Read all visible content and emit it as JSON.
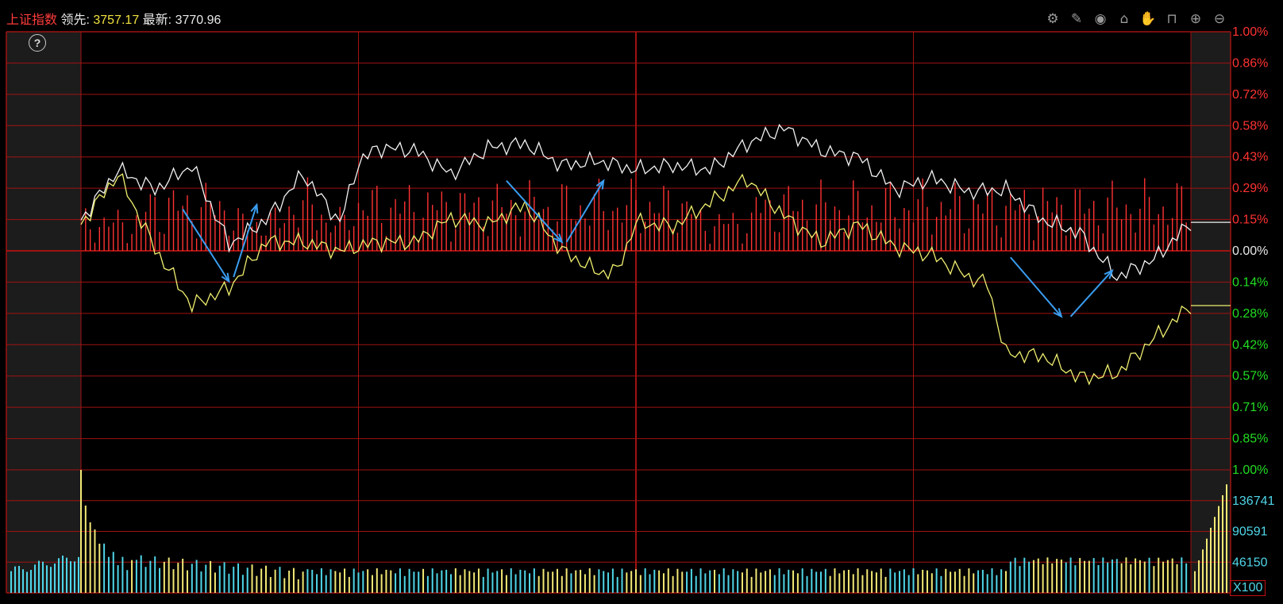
{
  "header": {
    "index_name": "上证指数",
    "lead_label": "领先:",
    "lead_value": "3757.17",
    "latest_label": "最新:",
    "latest_value": "3770.96"
  },
  "toolbar": {
    "icons": [
      "gear-icon",
      "pen-icon",
      "eye-icon",
      "tool-box-icon",
      "hand-icon",
      "lock-icon",
      "zoom-in-icon",
      "zoom-out-icon"
    ]
  },
  "colors": {
    "grid": "#a01212",
    "up": "#ff3232",
    "down": "#22dd22",
    "white_line": "#f2f2f2",
    "yellow_line": "#f0ef70",
    "volume_yellow": "#f2e874",
    "volume_cyan": "#4fd6e8",
    "arrow": "#3a9df0"
  },
  "volume_multiplier": "X100",
  "chart_data": [
    {
      "type": "line",
      "panel": "intraday price",
      "y_labels_right": [
        "1.00%",
        "0.86%",
        "0.72%",
        "0.58%",
        "0.43%",
        "0.29%",
        "0.15%",
        "0.00%",
        "0.14%",
        "0.28%",
        "0.42%",
        "0.57%",
        "0.71%",
        "0.85%",
        "1.00%"
      ],
      "ylim": [
        -1.0,
        1.0
      ],
      "x_range": [
        0,
        240
      ],
      "series": [
        {
          "color": "white",
          "x": [
            0,
            8,
            16,
            24,
            32,
            40,
            48,
            56,
            60,
            64,
            72,
            80,
            88,
            96,
            104,
            112,
            120,
            128,
            136,
            144,
            152,
            160,
            164,
            168,
            176,
            184,
            192,
            200,
            208,
            216,
            224,
            232,
            240
          ],
          "y": [
            0.14,
            0.37,
            0.28,
            0.39,
            0.03,
            0.14,
            0.35,
            0.13,
            0.4,
            0.47,
            0.46,
            0.35,
            0.47,
            0.49,
            0.39,
            0.41,
            0.37,
            0.39,
            0.37,
            0.49,
            0.56,
            0.46,
            0.44,
            0.43,
            0.28,
            0.33,
            0.27,
            0.28,
            0.14,
            0.08,
            -0.12,
            -0.04,
            0.13
          ]
        },
        {
          "color": "yellow",
          "x": [
            0,
            8,
            16,
            24,
            32,
            40,
            48,
            56,
            64,
            72,
            80,
            88,
            96,
            104,
            112,
            116,
            120,
            128,
            136,
            144,
            152,
            160,
            168,
            176,
            184,
            192,
            196,
            200,
            208,
            216,
            224,
            232,
            240
          ],
          "y": [
            0.12,
            0.35,
            0.01,
            -0.25,
            -0.17,
            0.04,
            0.04,
            0.0,
            0.04,
            0.04,
            0.15,
            0.12,
            0.21,
            0.0,
            -0.1,
            -0.09,
            0.13,
            0.11,
            0.22,
            0.33,
            0.16,
            0.04,
            0.12,
            0.02,
            -0.02,
            -0.12,
            -0.15,
            -0.47,
            -0.48,
            -0.58,
            -0.56,
            -0.4,
            -0.25
          ]
        }
      ]
    },
    {
      "type": "bar",
      "panel": "volume",
      "y_labels_right": [
        "136741",
        "90591",
        "46150"
      ],
      "ylim": [
        0,
        170000
      ]
    }
  ]
}
